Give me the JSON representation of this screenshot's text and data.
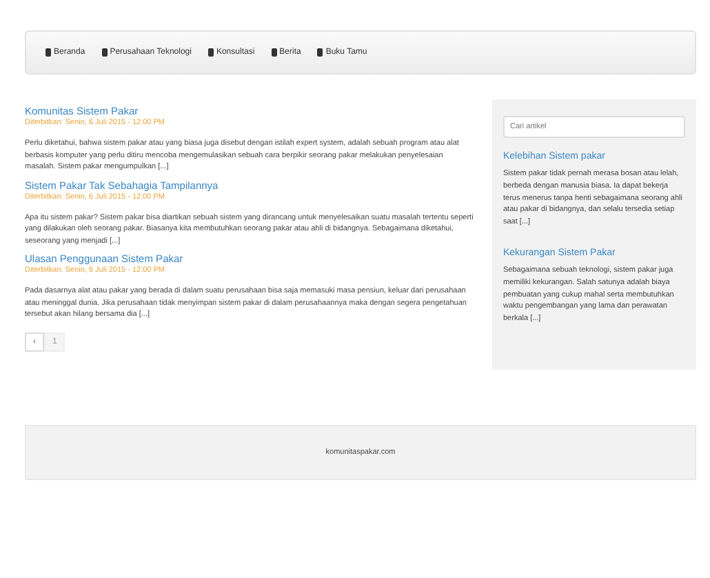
{
  "nav": [
    {
      "label": "Beranda"
    },
    {
      "label": "Perusahaan Teknologi"
    },
    {
      "label": "Konsultasi"
    },
    {
      "label": "Berita"
    },
    {
      "label": "Buku Tamu"
    }
  ],
  "posts": [
    {
      "title": "Komunitas Sistem Pakar",
      "date": "Diterbitkan: Senin, 6 Juli 2015 - 12:00 PM",
      "excerpt": "Perlu diketahui, bahwa sistem pakar atau yang biasa juga disebut dengan istilah expert system, adalah sebuah program atau alat berbasis komputer yang perlu ditiru mencoba mengemulasikan sebuah cara berpikir seorang pakar melakukan penyelesaian masalah. Sistem pakar mengumpulkan [...]"
    },
    {
      "title": "Sistem Pakar Tak Sebahagia Tampilannya",
      "date": "Diterbitkan: Senin, 6 Juli 2015 - 12:00 PM",
      "excerpt": "Apa itu sistem pakar? Sistem pakar bisa diartikan sebuah sistem yang dirancang untuk menyelesaikan suatu masalah tertentu seperti yang dilakukan oleh seorang pakar. Biasanya kita membutuhkan seorang pakar atau ahli di bidangnya. Sebagaimana diketahui, seseorang yang menjadi [...]"
    },
    {
      "title": "Ulasan Penggunaan Sistem Pakar",
      "date": "Diterbitkan: Senin, 6 Juli 2015 - 12:00 PM",
      "excerpt": "Pada dasarnya alat atau pakar yang berada di dalam suatu perusahaan bisa saja memasuki masa pensiun, keluar dari perusahaan atau meninggal dunia. Jika perusahaan tidak menyimpan sistem pakar di dalam perusahaannya maka dengan segera pengetahuan tersebut akan hilang bersama dia [...]"
    }
  ],
  "pagination": [
    {
      "label": "‹",
      "selected": false
    },
    {
      "label": "1",
      "selected": true
    }
  ],
  "sidebar": {
    "search": {
      "placeholder": "Cari artikel"
    },
    "widgets": [
      {
        "title": "Kelebihan Sistem pakar",
        "text": "Sistem pakar tidak pernah merasa bosan atau lelah, berbeda dengan manusia biasa. Ia dapat bekerja terus menerus tanpa henti sebagaimana seorang ahli atau pakar di bidangnya, dan selalu tersedia setiap saat [...]"
      },
      {
        "title": "Kekurangan Sistem Pakar",
        "text": "Sebagaimana sebuah teknologi, sistem pakar juga memiliki kekurangan. Salah satunya adalah biaya pembuatan yang cukup mahal serta membutuhkan waktu pengembangan yang lama dan perawatan berkala [...]"
      }
    ]
  },
  "footer": "komunitaspakar.com"
}
